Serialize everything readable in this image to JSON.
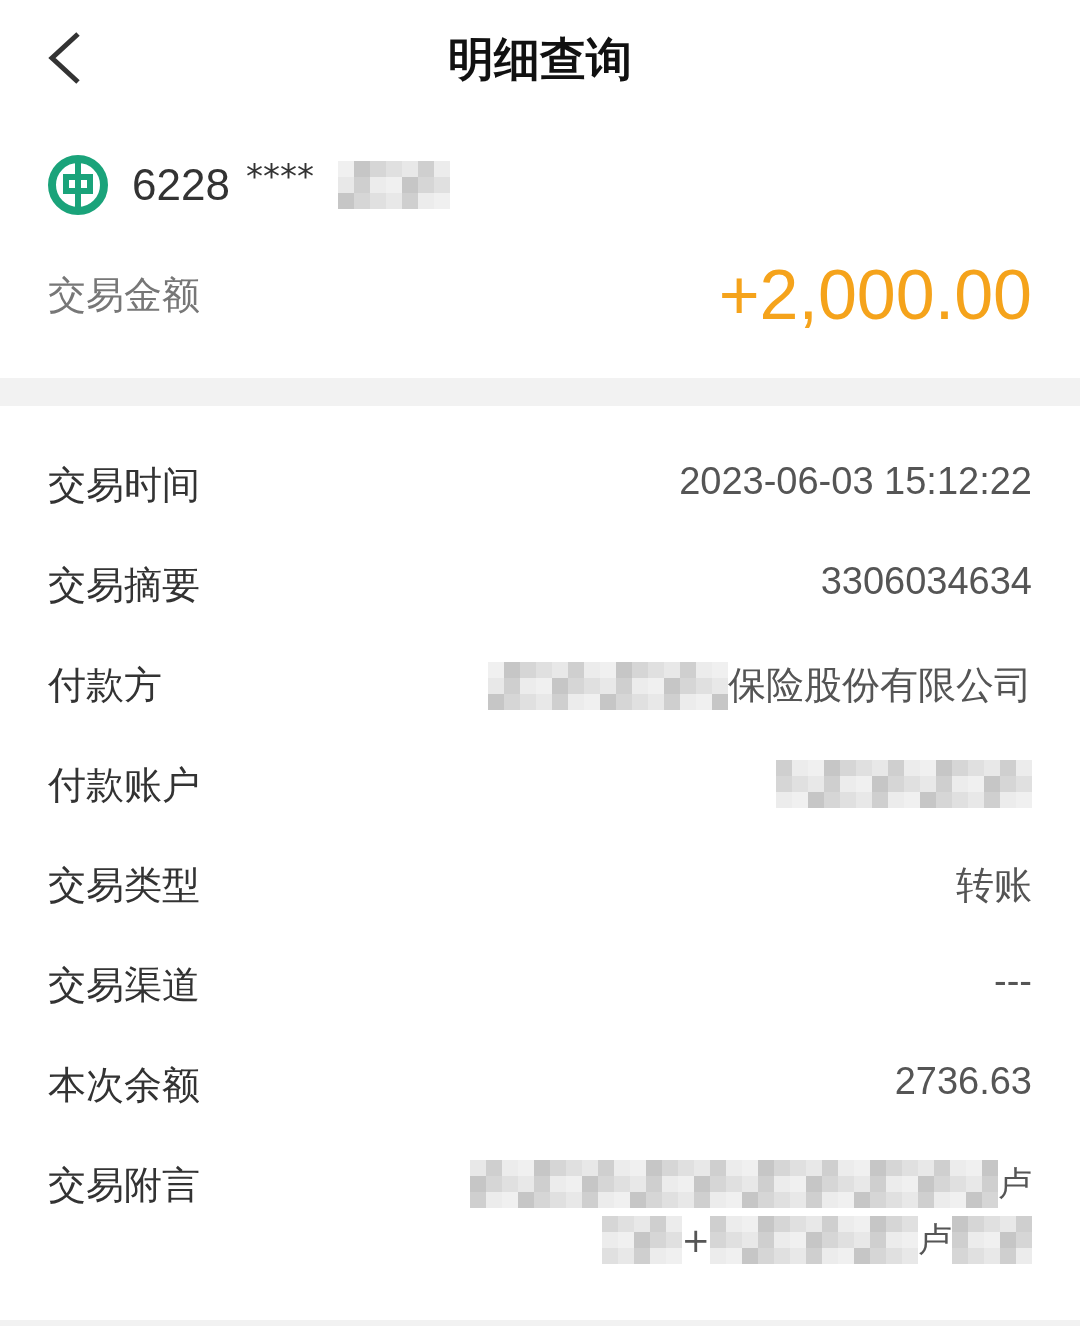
{
  "header": {
    "title": "明细查询"
  },
  "account": {
    "number": "6228",
    "mask": "****"
  },
  "amount": {
    "label": "交易金额",
    "value": "+2,000.00"
  },
  "details": [
    {
      "label": "交易时间",
      "kind": "text",
      "value": "2023-06-03 15:12:22"
    },
    {
      "label": "交易摘要",
      "kind": "text",
      "value": "3306034634"
    },
    {
      "label": "付款方",
      "kind": "masked_prefix",
      "value": "保险股份有限公司"
    },
    {
      "label": "付款账户",
      "kind": "masked"
    },
    {
      "label": "交易类型",
      "kind": "text",
      "value": "转账"
    },
    {
      "label": "交易渠道",
      "kind": "text",
      "value": "---"
    },
    {
      "label": "本次余额",
      "kind": "text",
      "value": "2736.63"
    },
    {
      "label": "交易附言",
      "kind": "masked_lines",
      "lines": [
        [
          {
            "kind": "mosaic"
          },
          {
            "kind": "text",
            "text": "卢"
          }
        ],
        [
          {
            "kind": "mosaic"
          },
          {
            "kind": "text",
            "text": "+"
          },
          {
            "kind": "mosaic"
          },
          {
            "kind": "text",
            "text": "卢"
          },
          {
            "kind": "mosaic"
          }
        ]
      ]
    }
  ]
}
